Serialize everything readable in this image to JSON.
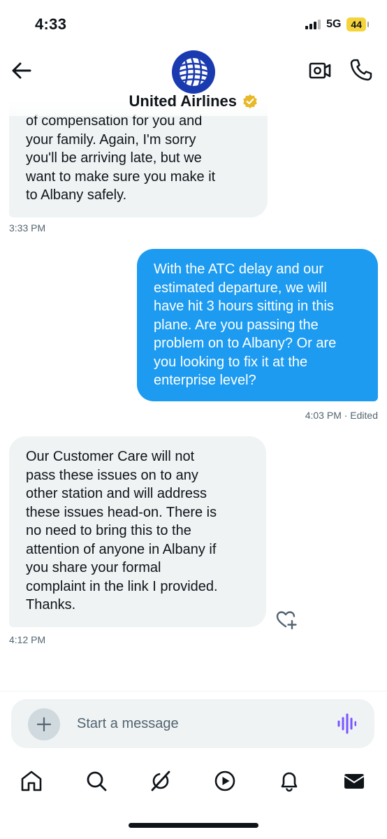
{
  "status_bar": {
    "time": "4:33",
    "network": "5G",
    "battery": "44"
  },
  "header": {
    "contact_name": "United Airlines",
    "back_icon": "arrow-left-icon",
    "video_icon": "video-call-icon",
    "call_icon": "phone-icon",
    "verified_icon": "verified-badge-icon"
  },
  "messages": [
    {
      "direction": "incoming",
      "lines": [
        "of compensation for you and",
        "your family. Again, I'm sorry",
        "you'll be arriving late, but we",
        "want to make sure you make it",
        "to Albany safely."
      ],
      "time": "3:33 PM"
    },
    {
      "direction": "outgoing",
      "lines": [
        "With the ATC delay and our",
        "estimated departure, we will",
        "have hit 3 hours sitting in this",
        "plane. Are you passing the",
        "problem on to Albany? Or are",
        "you looking to fix it at the",
        "enterprise level?"
      ],
      "time": "4:03 PM · Edited"
    },
    {
      "direction": "incoming",
      "lines": [
        "Our Customer Care will not",
        "pass these issues on to any",
        "other station and will address",
        "these issues head-on. There is",
        "no need to bring this to the",
        "attention of anyone in Albany if",
        "you share your formal",
        "complaint in the link I provided.",
        "Thanks."
      ],
      "time": "4:12 PM",
      "reaction_icon": "add-reaction-heart-icon"
    }
  ],
  "composer": {
    "placeholder": "Start a message",
    "add_icon": "plus-icon",
    "voice_icon": "voice-waveform-icon"
  },
  "colors": {
    "accent": "#1d9bf0",
    "incoming_bubble": "#eff3f4",
    "verified_gold": "#e8b829",
    "voice_purple": "#7856ff"
  },
  "nav": [
    "home-icon",
    "search-icon",
    "grok-icon",
    "play-icon",
    "bell-icon",
    "mail-icon"
  ]
}
